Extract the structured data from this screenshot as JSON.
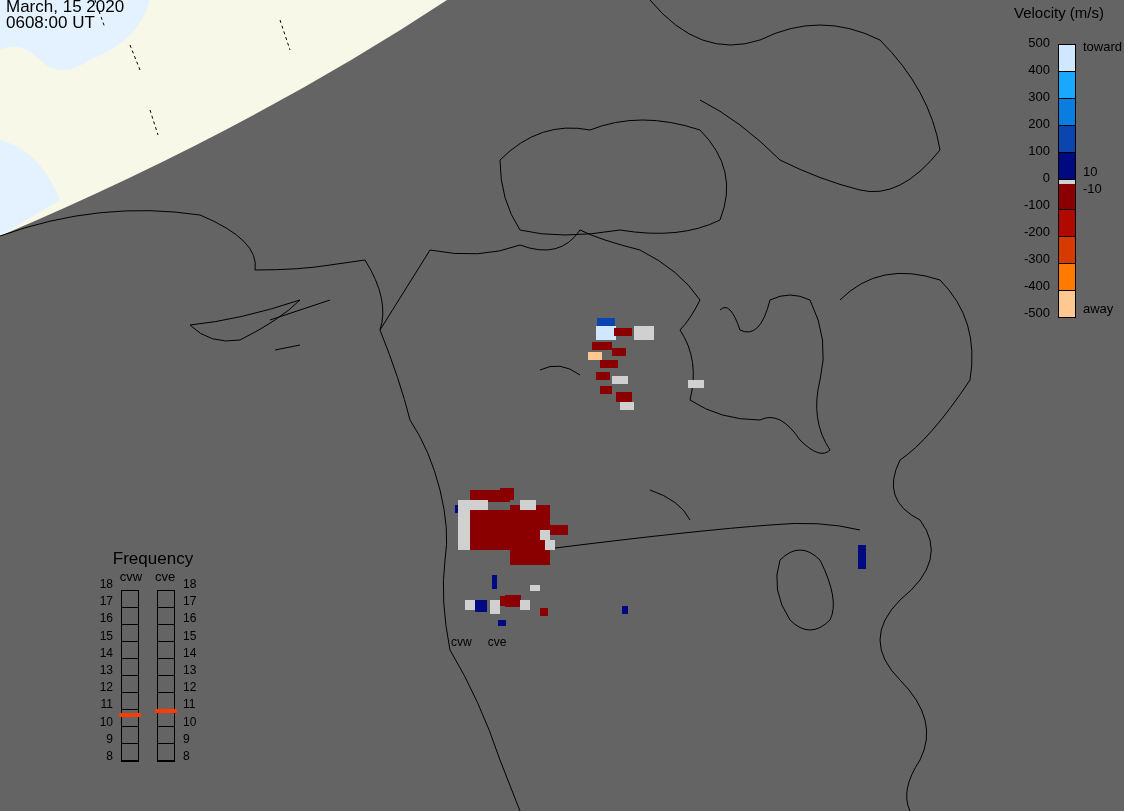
{
  "header": {
    "date": "March, 15 2020",
    "time": "0608:00 UT"
  },
  "velocity_legend": {
    "title": "Velocity (m/s)",
    "ticks": [
      "500",
      "400",
      "300",
      "200",
      "100",
      "0",
      "-100",
      "-200",
      "-300",
      "-400",
      "-500"
    ],
    "side_labels": [
      {
        "kind": "top",
        "text": "toward"
      },
      {
        "kind": "upper_mid",
        "text": "10"
      },
      {
        "kind": "lower_mid",
        "text": "-10"
      },
      {
        "kind": "bottom",
        "text": "away"
      }
    ]
  },
  "frequency": {
    "title": "Frequency",
    "radars": [
      {
        "name": "cvw",
        "kind": "left",
        "level": 0.26,
        "ticks": [
          "18",
          "17",
          "16",
          "15",
          "14",
          "13",
          "12",
          "11",
          "10",
          "9",
          "8"
        ]
      },
      {
        "name": "cve",
        "kind": "right",
        "level": 0.28,
        "ticks": [
          "18",
          "17",
          "16",
          "15",
          "14",
          "13",
          "12",
          "11",
          "10",
          "9",
          "8"
        ]
      }
    ]
  },
  "map": {
    "radar_labels": [
      "cvw",
      "cve"
    ]
  }
}
